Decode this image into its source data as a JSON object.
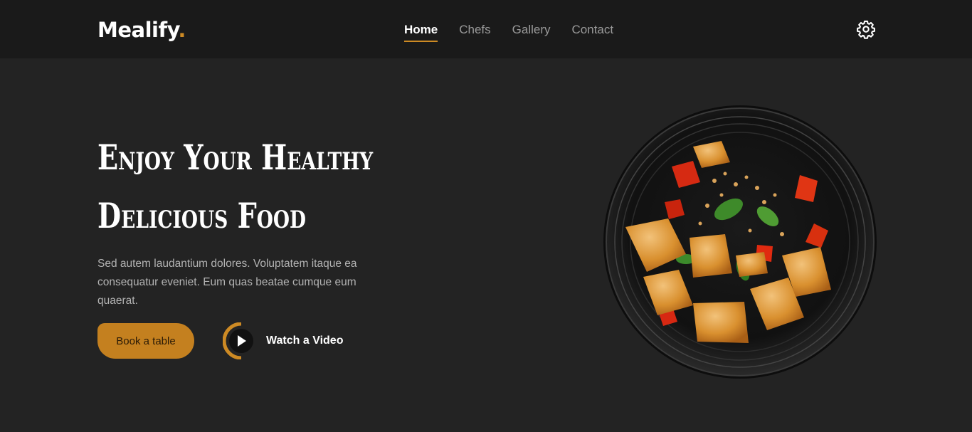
{
  "header": {
    "logo_text": "Mealify",
    "logo_dot": ".",
    "nav": [
      "Home",
      "Chefs",
      "Gallery",
      "Contact"
    ],
    "active_nav": "Home",
    "settings_icon": "gear-icon"
  },
  "hero": {
    "title_line1": "Enjoy Your Healthy",
    "title_line2": "Delicious Food",
    "description": "Sed autem laudantium dolores. Voluptatem itaque ea consequatur eveniet. Eum quas beatae cumque eum quaerat.",
    "book_button": "Book a table",
    "video_label": "Watch a Video",
    "video_icon": "play-icon"
  },
  "colors": {
    "background": "#232323",
    "header_bg": "#1a1a1a",
    "accent": "#cd8a24",
    "nav_inactive": "#9a9a9a",
    "description": "#b3b3b3"
  }
}
